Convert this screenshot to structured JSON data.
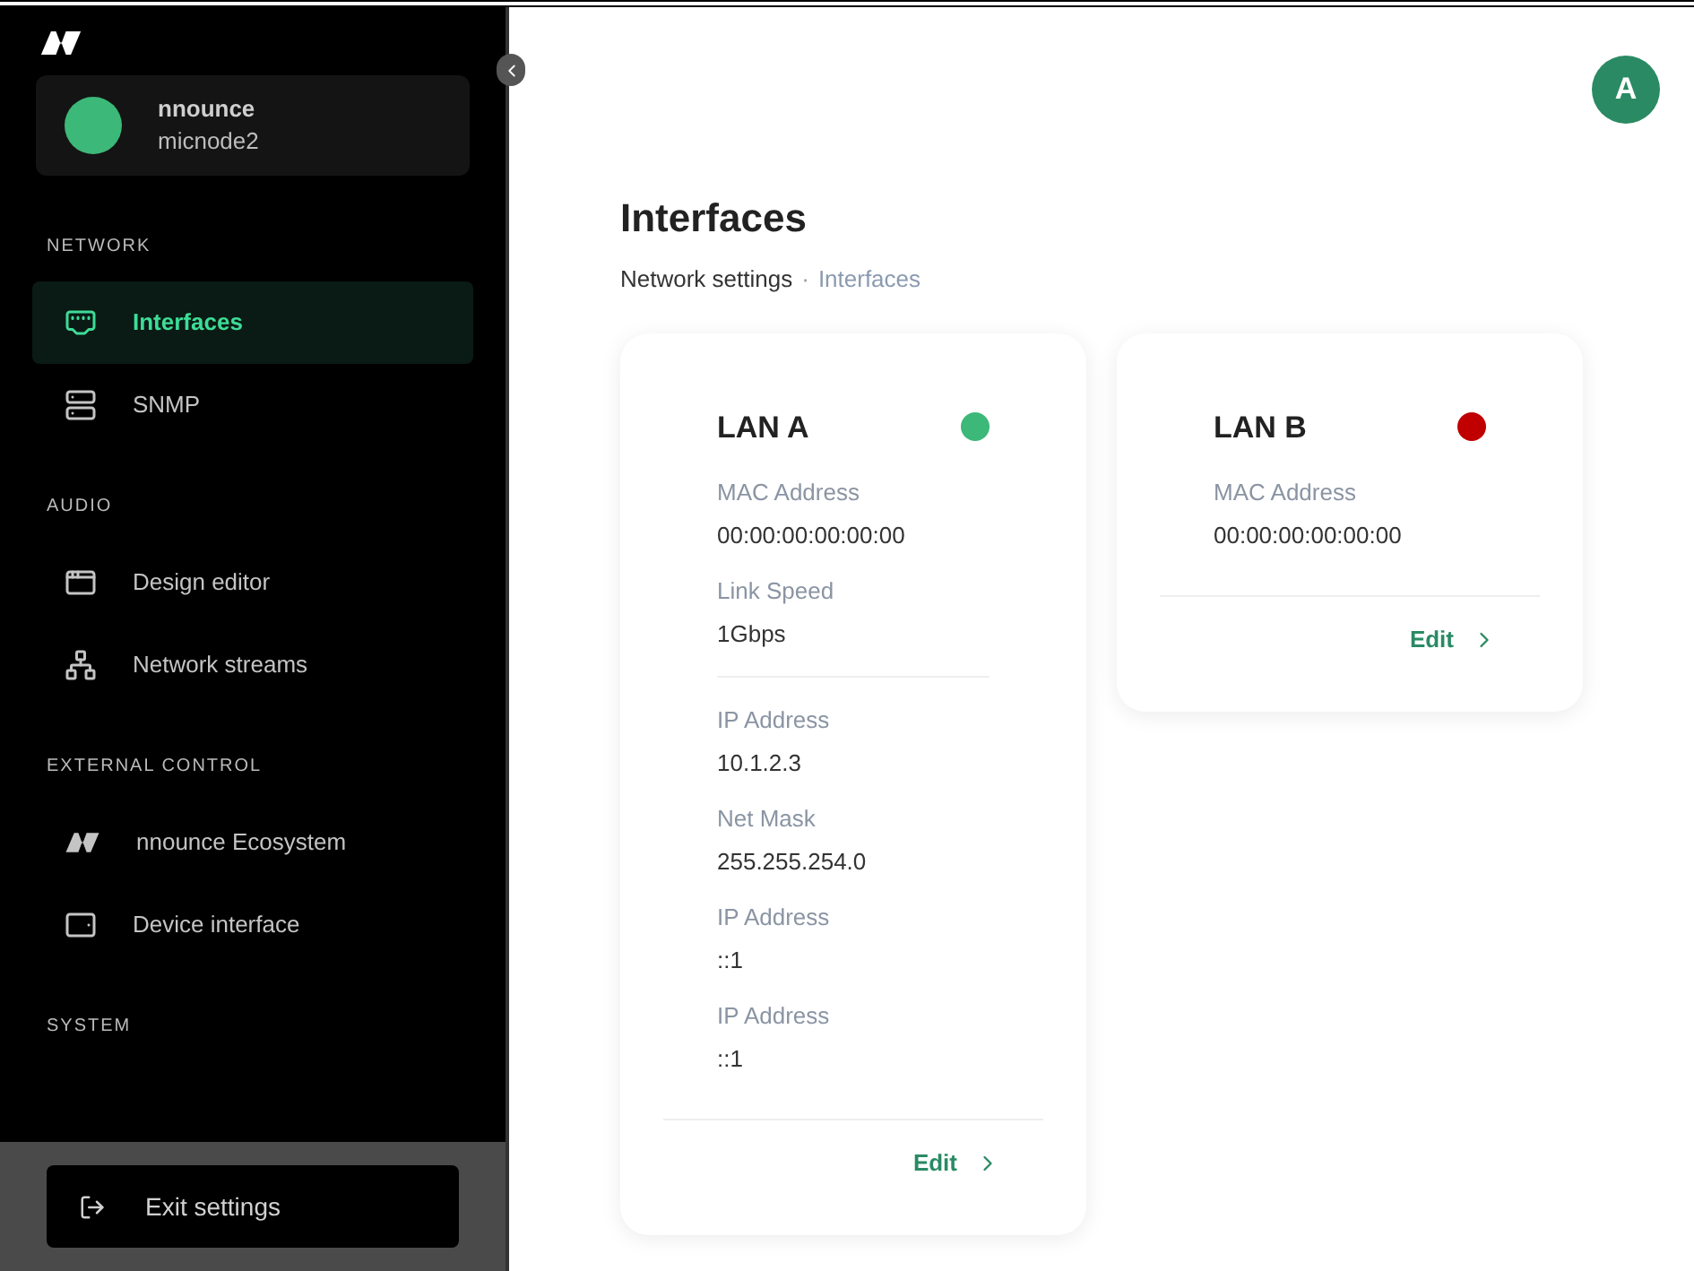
{
  "sidebar": {
    "device": {
      "brand": "nnounce",
      "name": "micnode2",
      "color": "#3cb878"
    },
    "sections": [
      {
        "title": "NETWORK",
        "items": [
          {
            "label": "Interfaces",
            "selected": true
          },
          {
            "label": "SNMP",
            "selected": false
          }
        ]
      },
      {
        "title": "AUDIO",
        "items": [
          {
            "label": "Design editor",
            "selected": false
          },
          {
            "label": "Network streams",
            "selected": false
          }
        ]
      },
      {
        "title": "EXTERNAL CONTROL",
        "items": [
          {
            "label": "nnounce Ecosystem",
            "selected": false
          },
          {
            "label": "Device interface",
            "selected": false
          }
        ]
      },
      {
        "title": "SYSTEM"
      }
    ],
    "exit_button": "Exit settings"
  },
  "avatar": "A",
  "page": {
    "title": "Interfaces",
    "breadcrumb": [
      "Network settings",
      "Interfaces"
    ],
    "breadcrumb_separator": "·"
  },
  "cards": [
    {
      "title": "LAN A",
      "color": "#3cb878",
      "groups": [
        [
          {
            "label": "MAC Address",
            "value": "00:00:00:00:00:00"
          },
          {
            "label": "Link Speed",
            "value": "1Gbps"
          }
        ],
        [
          {
            "label": "IP Address",
            "value": "10.1.2.3"
          },
          {
            "label": "Net Mask",
            "value": "255.255.254.0"
          },
          {
            "label": "IP Address",
            "value": "::1"
          },
          {
            "label": "IP Address",
            "value": "::1"
          }
        ]
      ],
      "edit": "Edit"
    },
    {
      "title": "LAN B",
      "color": "#c00000",
      "groups": [
        [
          {
            "label": "MAC Address",
            "value": "00:00:00:00:00:00"
          }
        ]
      ],
      "edit": "Edit"
    }
  ]
}
